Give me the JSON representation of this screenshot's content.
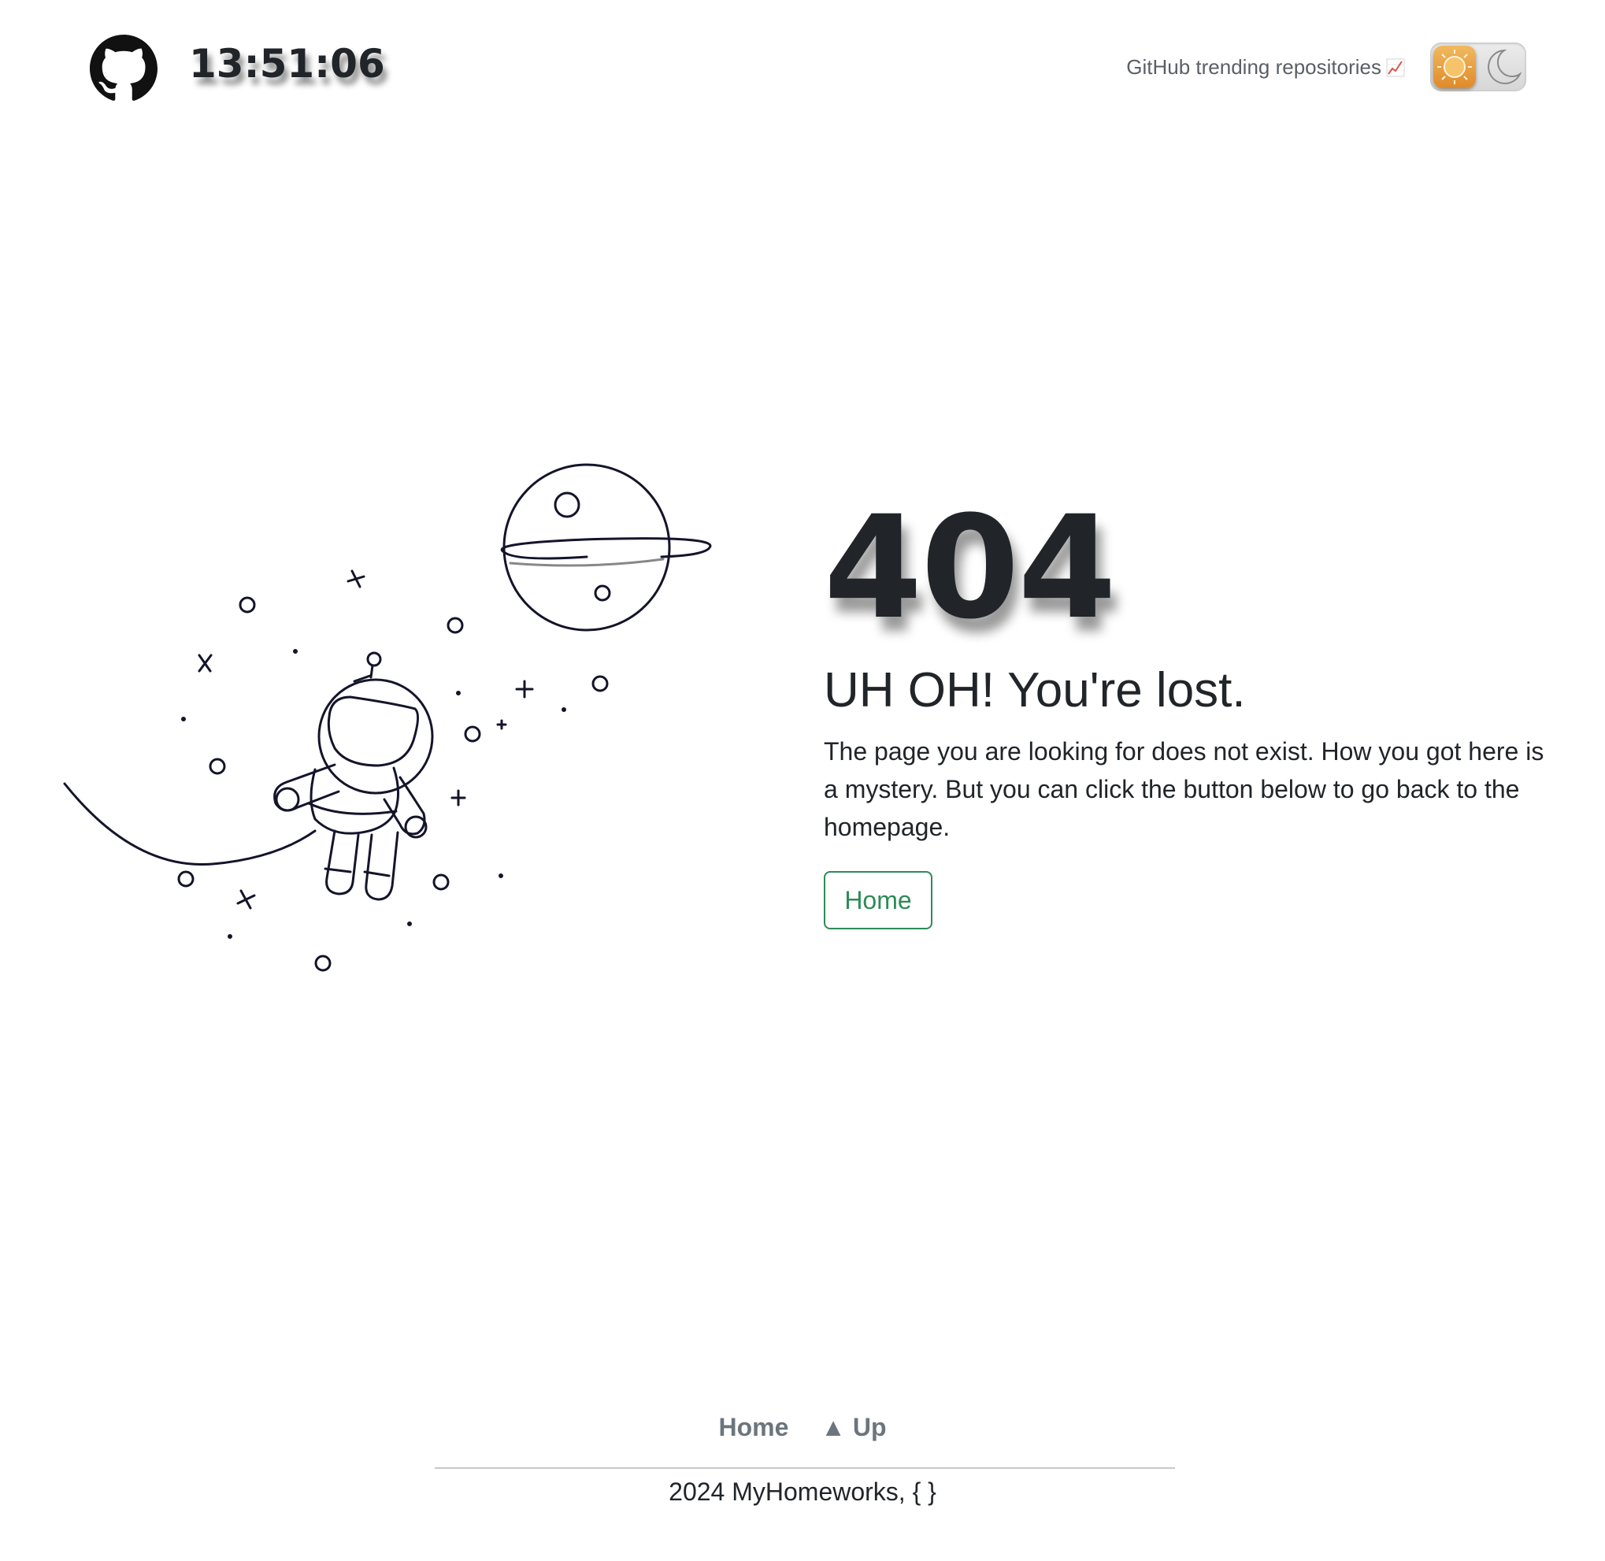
{
  "header": {
    "clock": "13:51:06",
    "trending_link": "GitHub trending repositories",
    "trending_icon": "chart-increasing-icon",
    "theme_mode": "light"
  },
  "main": {
    "code": "404",
    "title": "UH OH! You're lost.",
    "description": "The page you are looking for does not exist. How you got here is a mystery. But you can click the button below to go back to the homepage.",
    "home_button": "Home"
  },
  "footer": {
    "nav_home": "Home",
    "nav_up_arrow": "▲",
    "nav_up": "Up",
    "copyright": "2024 MyHomeworks, { }"
  },
  "colors": {
    "text": "#212529",
    "accent_green": "#2e8b57",
    "muted": "#6c757d",
    "toggle_sun": "#e6a03c"
  }
}
